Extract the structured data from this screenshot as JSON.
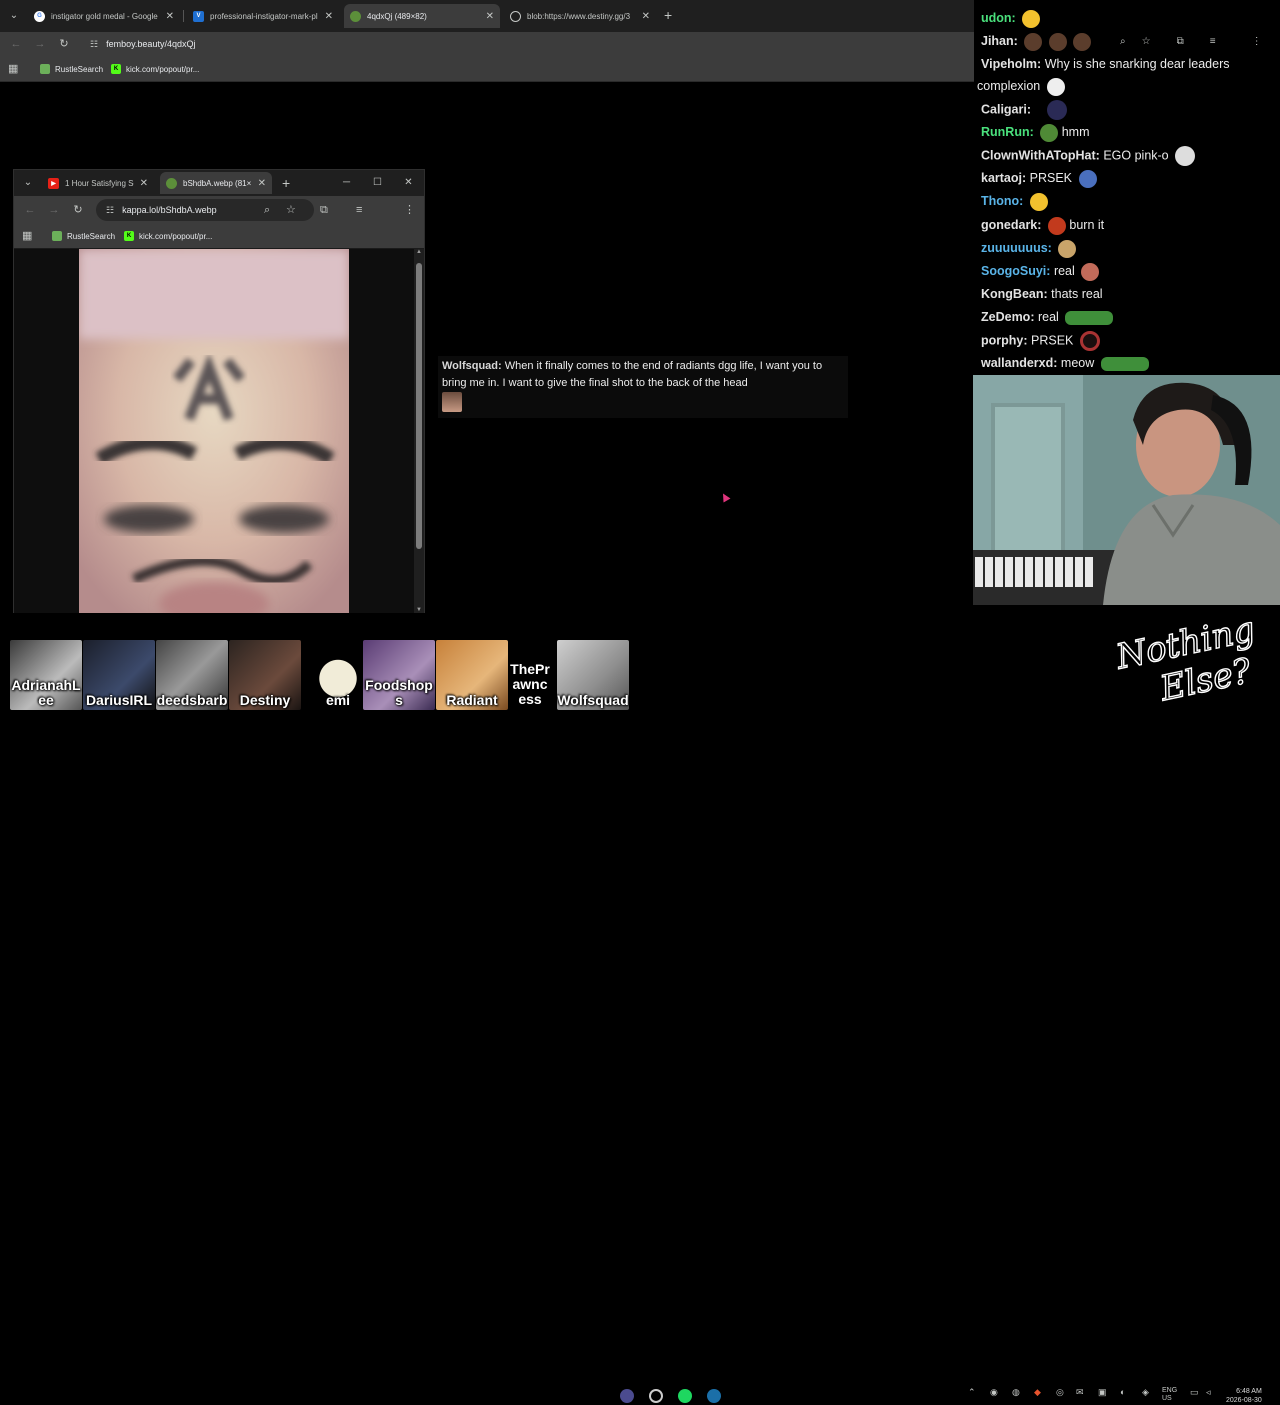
{
  "main_browser": {
    "tabs": [
      {
        "title": "instigator gold medal - Google",
        "icon": "google-icon"
      },
      {
        "title": "professional-instigator-mark-pl",
        "icon": "vintagetees-icon"
      },
      {
        "title": "4qdxQj (489×82)",
        "icon": "pepe-icon",
        "active": true
      },
      {
        "title": "blob:https://www.destiny.gg/3",
        "icon": "globe-icon"
      }
    ],
    "url": "femboy.beauty/4qdxQj",
    "bookmarks": [
      {
        "label": "RustleSearch",
        "icon": "rustle-icon"
      },
      {
        "label": "kick.com/popout/pr...",
        "icon": "kick-icon"
      }
    ]
  },
  "inner_browser": {
    "tabs": [
      {
        "title": "1 Hour Satisfying So",
        "icon": "youtube-icon"
      },
      {
        "title": "bShdbA.webp (81×",
        "icon": "pepe-icon",
        "active": true
      }
    ],
    "url": "kappa.lol/bShdbA.webp",
    "bookmarks": [
      {
        "label": "RustleSearch",
        "icon": "rustle-icon"
      },
      {
        "label": "kick.com/popout/pr...",
        "icon": "kick-icon"
      }
    ]
  },
  "overlay_message": {
    "user": "Wolfsquad:",
    "text": "When it finally comes to the end of radiants dgg life, I want you to bring me in. I want to give the final shot to the back of the head"
  },
  "chat": [
    {
      "user": "udon:",
      "text": "",
      "user_color": "green",
      "emote": "thumbs-emote"
    },
    {
      "user": "Jihan:",
      "text": "",
      "user_color": "white",
      "emote": "faces-emote"
    },
    {
      "user": "Vipeholm:",
      "text": "Why is she snarking dear leaders",
      "user_color": "white"
    },
    {
      "user": "",
      "text": "complexion",
      "user_color": "white",
      "emote": "troll-emote"
    },
    {
      "user": "Caligari:",
      "text": "",
      "user_color": "white",
      "emote": "ghost-emote"
    },
    {
      "user": "RunRun:",
      "text": "hmm",
      "user_color": "green",
      "emote": "pepe-emote"
    },
    {
      "user": "ClownWithATopHat:",
      "text": "EGO pink-o",
      "user_color": "white",
      "emote": "clown-emote"
    },
    {
      "user": "kartaoj:",
      "text": "PRSEK",
      "user_color": "white",
      "emote": "robot-emote"
    },
    {
      "user": "Thono:",
      "text": "",
      "user_color": "blue",
      "emote": "thumbs-emote"
    },
    {
      "user": "gonedark:",
      "text": "burn it",
      "user_color": "white",
      "emote": "fire-emote"
    },
    {
      "user": "zuuuuuuus:",
      "text": "",
      "user_color": "blue",
      "emote": "cat-emote"
    },
    {
      "user": "SoogoSuyi:",
      "text": "real",
      "user_color": "blue",
      "emote": "face-emote"
    },
    {
      "user": "KongBean:",
      "text": "thats real",
      "user_color": "white"
    },
    {
      "user": "ZeDemo:",
      "text": "real",
      "user_color": "white",
      "emote": "table-emote"
    },
    {
      "user": "porphy:",
      "text": "PRSEK",
      "user_color": "white",
      "emote": "ball-emote"
    },
    {
      "user": "wallanderxd:",
      "text": "meow",
      "user_color": "white",
      "emote": "table-emote"
    }
  ],
  "viewers": [
    "AdrianahLee",
    "DariusIRL",
    "deedsbarb",
    "Destiny",
    "emi",
    "Foodshops",
    "Radiant",
    "ThePrawncess",
    "Wolfsquad"
  ],
  "logo_text": "Nothing Else?",
  "taskbar": {
    "lang": "ENG",
    "region": "US",
    "time": "6:48 AM",
    "date": "2026-08-30"
  },
  "colors": {
    "chrome_bg": "#1f1f1f",
    "toolbar_bg": "#3c3c3c",
    "chat_green": "#4ae07c",
    "chat_blue": "#5ab4e8"
  }
}
